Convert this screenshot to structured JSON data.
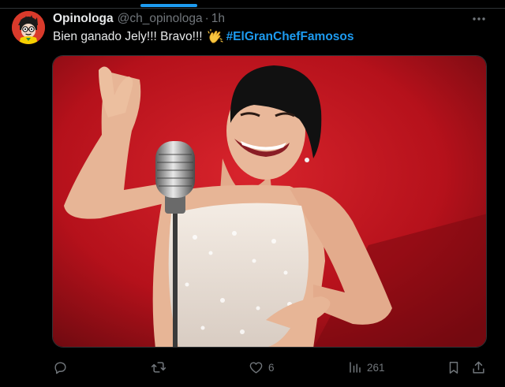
{
  "tweet": {
    "author": {
      "display_name": "Opinologa",
      "handle": "@ch_opinologa",
      "separator": "·",
      "time": "1h",
      "avatar_icon": "cartoon-avatar-icon"
    },
    "text": {
      "before_emoji": "Bien ganado Jely!!! Bravo!!!",
      "emoji_icon": "clapping-hands-icon",
      "hashtag": "#ElGranChefFamosos"
    },
    "media": {
      "type": "photo",
      "subject_icon": "singer-with-microphone-photo"
    },
    "actions": {
      "reply": {
        "icon": "reply-icon",
        "count": ""
      },
      "retweet": {
        "icon": "retweet-icon",
        "count": ""
      },
      "like": {
        "icon": "heart-icon",
        "count": "6"
      },
      "views": {
        "icon": "views-chart-icon",
        "count": "261"
      },
      "bookmark": {
        "icon": "bookmark-icon"
      },
      "share": {
        "icon": "share-icon"
      }
    }
  },
  "colors": {
    "background": "#000000",
    "text_primary": "#e7e9ea",
    "text_secondary": "#71767b",
    "accent": "#1d9bf0",
    "divider": "#2f3336",
    "photo_background": "#b5111b"
  }
}
